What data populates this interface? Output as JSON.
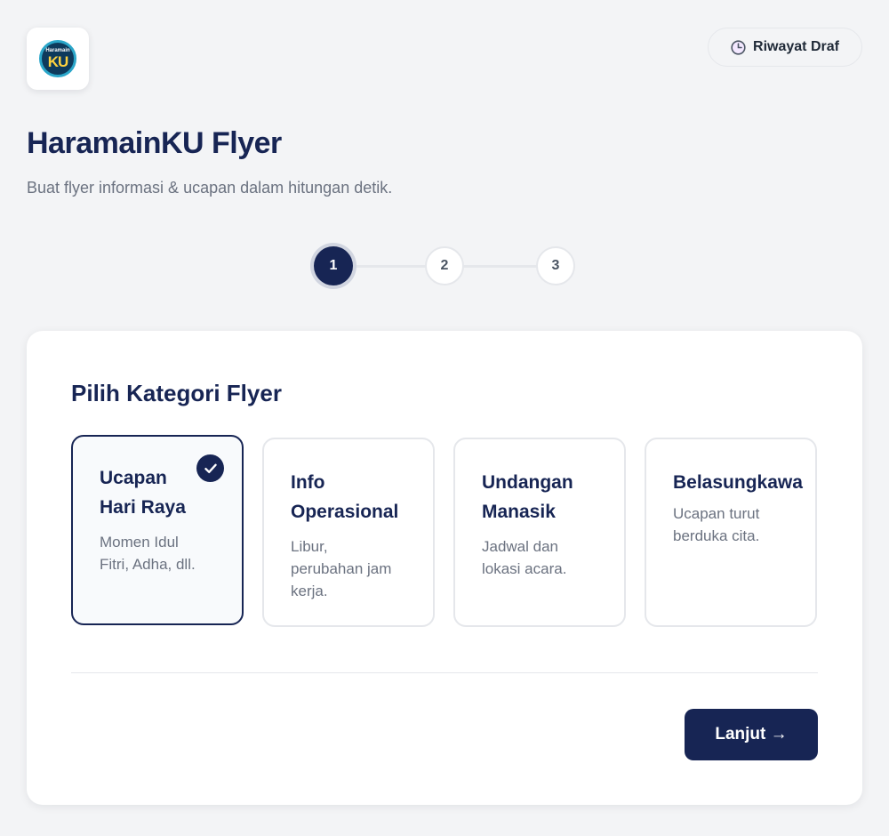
{
  "header": {
    "logo": {
      "line1": "Haramain",
      "line2": "KU",
      "icon": "haramainku-logo-icon",
      "badge_color": "#0e3a5c",
      "text_color": "#ffd23f",
      "ring_color": "#2aa6c9"
    },
    "history_button": {
      "label": "Riwayat Draf",
      "icon": "clock-icon"
    },
    "title": "HaramainKU Flyer",
    "subtitle": "Buat flyer informasi & ucapan dalam hitungan detik."
  },
  "stepper": {
    "steps": [
      {
        "label": "1",
        "state": "active"
      },
      {
        "label": "2",
        "state": "inactive"
      },
      {
        "label": "3",
        "state": "inactive"
      }
    ],
    "current": 1
  },
  "category_card": {
    "title": "Pilih Kategori Flyer",
    "options": [
      {
        "title": "Ucapan\nHari Raya",
        "description": "Momen Idul\nFitri, Adha, dll.",
        "selected": true
      },
      {
        "title": "Info\nOperasional",
        "description": "Libur,\nperubahan jam\nkerja.",
        "selected": false
      },
      {
        "title": "Undangan\nManasik",
        "description": "Jadwal dan\nlokasi acara.",
        "selected": false
      },
      {
        "title": "Belasungkawa",
        "description": "Ucapan turut\nberduka cita.",
        "selected": false
      }
    ],
    "next_button": {
      "label": "Lanjut →"
    }
  },
  "colors": {
    "primary": "#172554",
    "background": "#f3f4f6",
    "muted_text": "#6b7280",
    "border": "#e5e7eb"
  }
}
